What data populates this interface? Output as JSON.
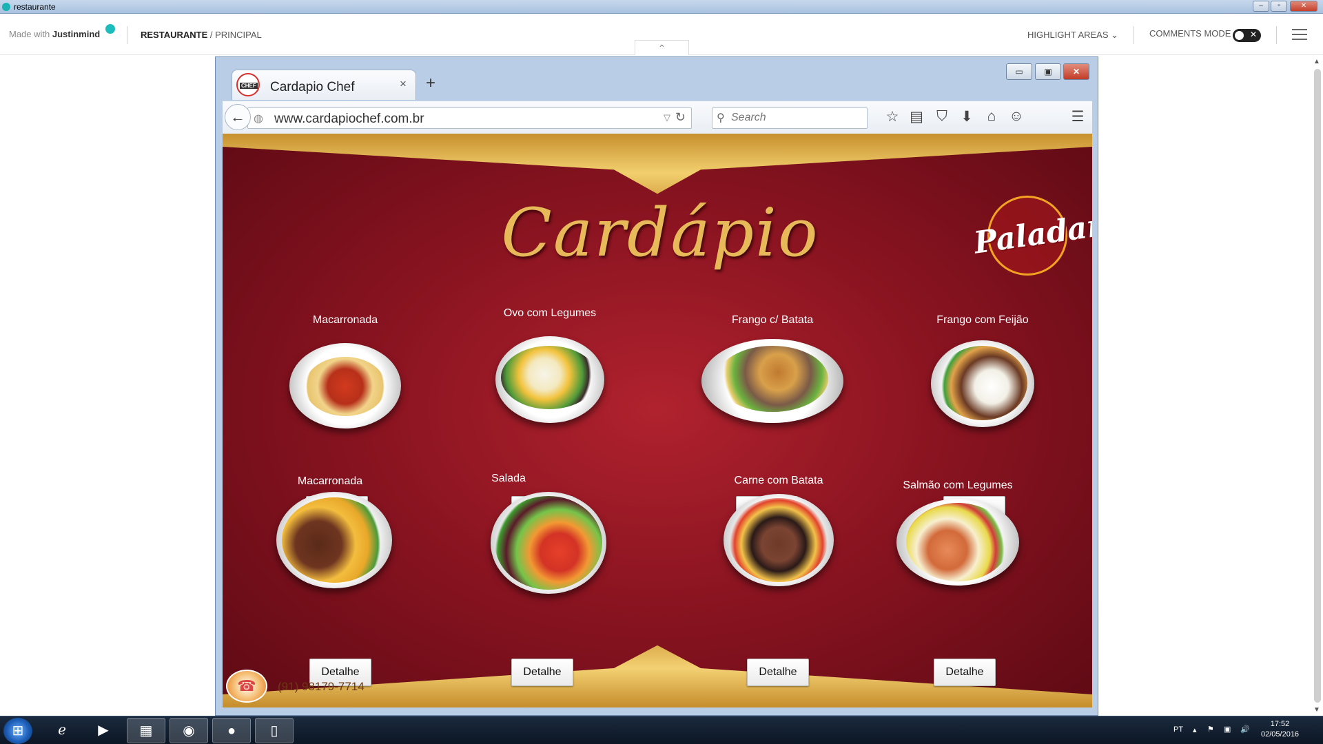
{
  "os": {
    "window_title": "restaurante"
  },
  "justinmind": {
    "made_with": "Made with",
    "brand": "Justinmind",
    "crumb_project": "RESTAURANTE",
    "crumb_sep": " / ",
    "crumb_page": "PRINCIPAL",
    "highlight": "HIGHLIGHT AREAS",
    "comments": "COMMENTS MODE"
  },
  "browser": {
    "tab_title": "Cardapio Chef",
    "tab_close": "×",
    "new_tab": "+",
    "url": "www.cardapiochef.com.br",
    "search_placeholder": "Search"
  },
  "page": {
    "heading": "Cardápio",
    "logo": "Paladar",
    "phone": "(91) 98179-7714",
    "button_label": "Detalhe",
    "dishes": [
      {
        "name": "Macarronada"
      },
      {
        "name": "Ovo com Legumes"
      },
      {
        "name": "Frango c/ Batata"
      },
      {
        "name": "Frango com Feijão"
      },
      {
        "name": "Macarronada"
      },
      {
        "name": "Salada"
      },
      {
        "name": "Carne com Batata"
      },
      {
        "name": "Salmão com Legumes"
      }
    ]
  },
  "taskbar": {
    "lang": "PT",
    "time": "17:52",
    "date": "02/05/2016"
  },
  "icons": [
    "restaurante-icon",
    "chef-favicon",
    "back-arrow-icon",
    "globe-icon",
    "reload-icon",
    "search-icon",
    "star-icon",
    "reading-list-icon",
    "pocket-icon",
    "download-icon",
    "home-icon",
    "chat-icon",
    "menu-icon",
    "phone-icon",
    "windows-start-icon",
    "ie-icon",
    "media-player-icon",
    "file-explorer-icon",
    "firefox-icon",
    "justinmind-icon",
    "document-icon"
  ]
}
